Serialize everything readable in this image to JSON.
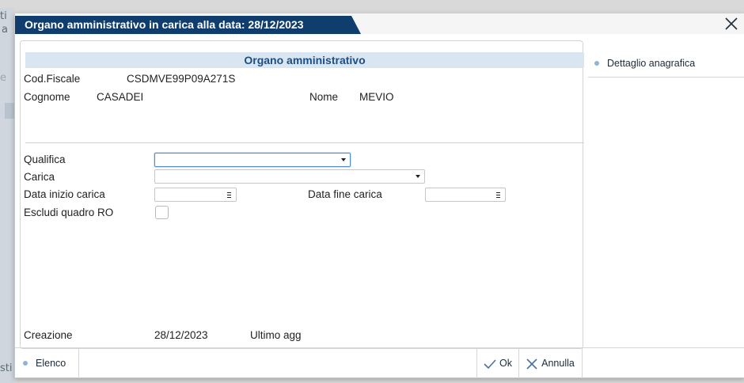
{
  "background": {
    "left_fragments": [
      "ti",
      "a",
      "e",
      "sti"
    ]
  },
  "dialog": {
    "title": "Organo amministrativo in carica alla data: 28/12/2023",
    "close_icon": "close-icon"
  },
  "section": {
    "header": "Organo amministrativo"
  },
  "anagrafica": {
    "cod_fiscale_label": "Cod.Fiscale",
    "cod_fiscale_value": "CSDMVE99P09A271S",
    "cognome_label": "Cognome",
    "cognome_value": "CASADEI",
    "nome_label": "Nome",
    "nome_value": "MEVIO"
  },
  "form": {
    "qualifica_label": "Qualifica",
    "qualifica_value": "",
    "carica_label": "Carica",
    "carica_value": "",
    "data_inizio_label": "Data inizio carica",
    "data_inizio_value": "",
    "data_fine_label": "Data fine carica",
    "data_fine_value": "",
    "escludi_label": "Escludi quadro RO",
    "escludi_checked": false
  },
  "meta": {
    "creazione_label": "Creazione",
    "creazione_value": "28/12/2023",
    "ultimo_agg_label": "Ultimo agg"
  },
  "side": {
    "items": [
      {
        "label": "Dettaglio anagrafica"
      }
    ]
  },
  "footer": {
    "elenco": "Elenco",
    "ok": "Ok",
    "annulla": "Annulla"
  },
  "colors": {
    "title_bg": "#0f3d6e",
    "section_bg": "#d9e6f2",
    "section_text": "#1d4e82",
    "focus": "#4f8fd1"
  }
}
